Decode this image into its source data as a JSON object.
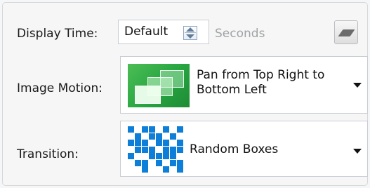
{
  "display_time": {
    "label": "Display Time:",
    "value": "Default",
    "unit": "Seconds",
    "eraser_icon": "eraser-icon"
  },
  "image_motion": {
    "label": "Image Motion:",
    "selected": "Pan from Top Right to Bottom Left",
    "thumbnail_icon": "pan-motion-thumbnail",
    "dropdown_icon": "chevron-down-icon"
  },
  "transition": {
    "label": "Transition:",
    "selected": "Random Boxes",
    "thumbnail_icon": "random-boxes-thumbnail",
    "dropdown_icon": "chevron-down-icon"
  },
  "colors": {
    "panel_bg": "#f6f6f6",
    "motion_green": "#2bac45",
    "transition_blue": "#0e7fd8",
    "placeholder_text": "#a0a3a6"
  }
}
